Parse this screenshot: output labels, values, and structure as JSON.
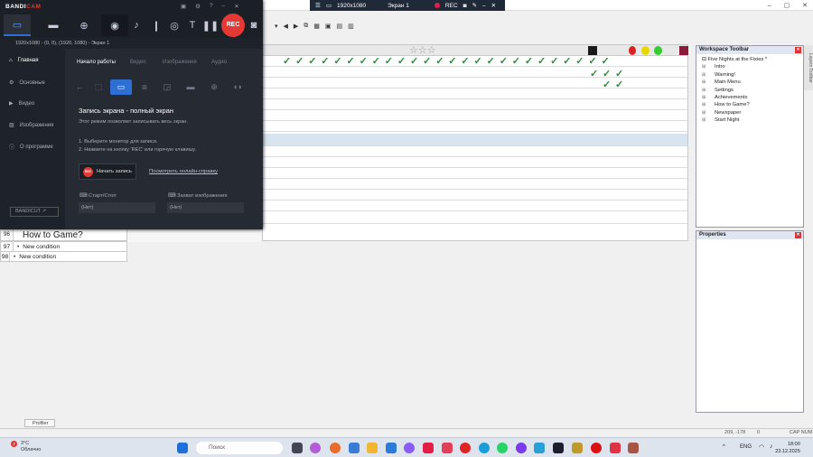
{
  "recbar": {
    "resolution": "1920x1080",
    "screen": "Экран 1",
    "rec": "REC"
  },
  "bandicam": {
    "logo_a": "BANDI",
    "logo_b": "CAM",
    "rec_label": "REC",
    "info": "1920x1080 - (0, 0), (1920, 1080) - Экран 1",
    "sidebar": [
      "Главная",
      "Основные",
      "Видео",
      "Изображения",
      "О программе"
    ],
    "bandicut": "BANDICUT ↗",
    "tabs": [
      "Начало работы",
      "Видео",
      "Изображения",
      "Аудио"
    ],
    "mode_title": "Запись экрана - полный экран",
    "mode_desc": "Этот режим позволяет записывать весь экран.",
    "step1": "1. Выберите монитор для записи.",
    "step2": "2. Нажмите на кнопку 'REC' или горячую клавишу.",
    "start_button": "Начать запись",
    "help_link": "Посмотреть онлайн-справку",
    "hotkey_start_label": "Старт/Стоп",
    "hotkey_start_value": "(Нет)",
    "hotkey_capture_label": "Захват изображения",
    "hotkey_capture_value": "(Нет)"
  },
  "events": [
    {
      "num": "96",
      "text": "How to Game?"
    },
    {
      "num": "97",
      "text": "New condition"
    },
    {
      "num": "98",
      "text": "New condition"
    }
  ],
  "workspace": {
    "title": "Workspace Toolbar",
    "project": "Five Nights at the Fixies *",
    "items": [
      "Intro",
      "Warning!",
      "Main Menu",
      "Settings",
      "Achievements",
      "How to Game?",
      "Newspaper",
      "Start Night"
    ]
  },
  "properties": {
    "title": "Properties"
  },
  "side_tab": "Layers Toolbar",
  "status": {
    "profiler": "Profiler",
    "coords": "209, -178",
    "zoom": "0",
    "caps": "CAP NUM"
  },
  "taskbar": {
    "temp": "3°C",
    "weather": "Облачно",
    "badge": "2",
    "search": "Поиск",
    "lang": "ENG",
    "time": "18:00",
    "date": "23.12.2025"
  },
  "colors": {
    "accent": "#2d6fd3",
    "rec": "#e53935",
    "check": "#2e8b3a"
  }
}
